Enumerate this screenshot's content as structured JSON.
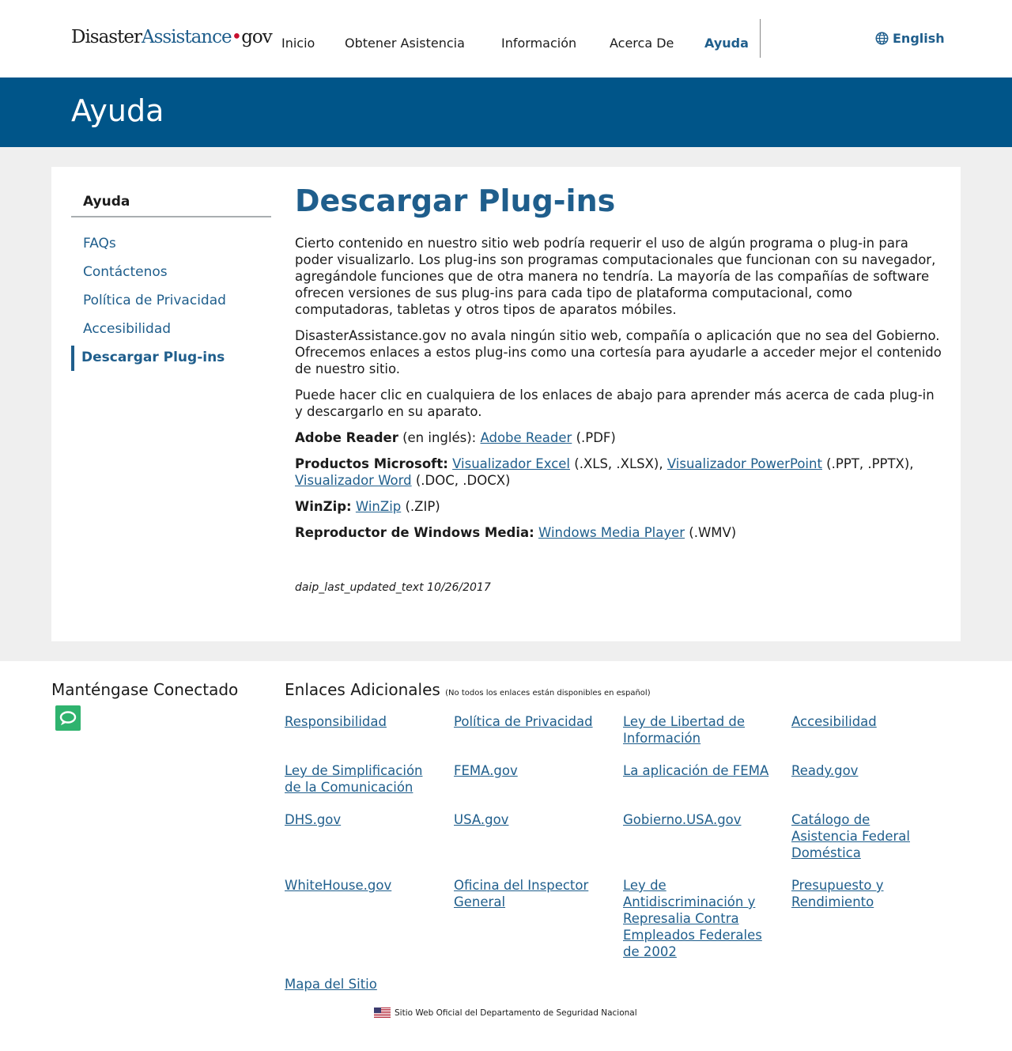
{
  "header": {
    "logo": {
      "part1": "Disaster",
      "part2": "Assistance",
      "part3": "gov"
    },
    "nav": [
      "Inicio",
      "Obtener Asistencia",
      "Información",
      "Acerca De",
      "Ayuda"
    ],
    "language_label": "English"
  },
  "banner": {
    "title": "Ayuda"
  },
  "sidebar": {
    "title": "Ayuda",
    "items": [
      "FAQs",
      "Contáctenos",
      "Política de Privacidad",
      "Accesibilidad",
      "Descargar Plug-ins"
    ],
    "active_item": "Descargar Plug-ins"
  },
  "main": {
    "title": "Descargar Plug-ins",
    "paragraphs": [
      "Cierto contenido en nuestro sitio web podría requerir el uso de algún programa o plug-in para poder visualizarlo. Los plug-ins son programas computacionales que funcionan con su navegador, agregándole funciones que de otra manera no tendría. La mayoría de las compañías de software ofrecen versiones de sus plug-ins para cada tipo de plataforma computacional, como computadoras, tabletas y otros tipos de aparatos móbiles.",
      "DisasterAssistance.gov no avala ningún sitio web, compañía o aplicación que no sea del Gobierno. Ofrecemos enlaces a estos plug-ins como una cortesía para ayudarle a acceder mejor el contenido de nuestro sitio.",
      "Puede hacer clic en cualquiera de los enlaces de abajo para aprender más acerca de cada plug-in y descargarlo en su aparato."
    ],
    "plugins": {
      "adobe": {
        "label": "Adobe Reader",
        "note": " (en inglés):",
        "link": "Adobe Reader",
        "ext": " (.PDF)"
      },
      "microsoft": {
        "label": "Productos Microsoft:",
        "excel": "Visualizador Excel",
        "excel_ext": " (.XLS, .XLSX), ",
        "ppt": "Visualizador PowerPoint",
        "ppt_ext": " (.PPT, .PPTX), ",
        "word": "Visualizador Word",
        "word_ext": " (.DOC, .DOCX)"
      },
      "winzip": {
        "label": "WinZip:",
        "link": "WinZip",
        "ext": " (.ZIP)"
      },
      "wmp": {
        "label": "Reproductor de Windows Media:",
        "link": "Windows Media Player",
        "ext": " (.WMV)"
      }
    },
    "last_updated": "daip_last_updated_text 10/26/2017"
  },
  "footer": {
    "connected_title": "Manténgase Conectado",
    "links_title": "Enlaces Adicionales",
    "links_note": "(No todos los enlaces están disponibles en español)",
    "links": [
      "Responsibilidad",
      "Política de Privacidad",
      "Ley de Libertad de Información",
      "Accesibilidad",
      "Ley de Simplificación de la Comunicación",
      "FEMA.gov",
      "La aplicación de FEMA",
      "Ready.gov",
      "DHS.gov",
      "USA.gov",
      "Gobierno.USA.gov",
      "Catálogo de Asistencia Federal Doméstica",
      "WhiteHouse.gov",
      "Oficina del Inspector General",
      "Ley de Antidiscriminación y Represalia Contra Empleados Federales de 2002",
      "Presupuesto y Rendimiento",
      "Mapa del Sitio"
    ],
    "official_text": "Sitio Web Oficial del Departamento de Seguridad Nacional"
  },
  "colors": {
    "primary": "#1f5e8c",
    "banner": "#005589",
    "content_bg": "#efefef",
    "chat": "#2fb36e",
    "logo_dot": "#c8102e"
  }
}
